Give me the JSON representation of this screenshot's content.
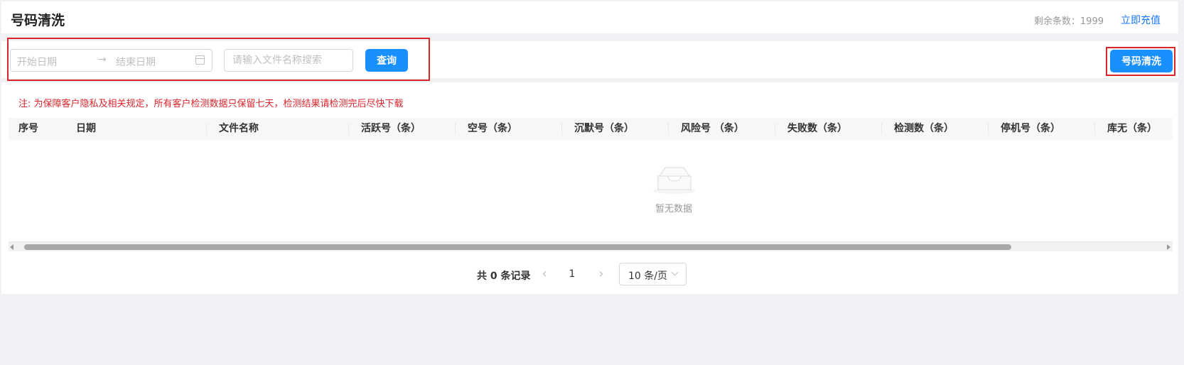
{
  "header": {
    "title": "号码清洗",
    "remaining": "剩余条数：1999",
    "recharge": "立即充值"
  },
  "filters": {
    "start_placeholder": "开始日期",
    "end_placeholder": "结束日期",
    "range_arrow": "→",
    "search_placeholder": "请输入文件名称搜索",
    "query_label": "查询"
  },
  "actions": {
    "clean_label": "号码清洗"
  },
  "notice": "注: 为保障客户隐私及相关规定，所有客户检测数据只保留七天，检测结果请检测完后尽快下载",
  "table": {
    "columns": [
      "序号",
      "日期",
      "文件名称",
      "活跃号（条）",
      "空号（条）",
      "沉默号（条）",
      "风险号 （条）",
      "失败数（条）",
      "检测数（条）",
      "停机号（条）",
      "库无（条）"
    ],
    "empty_text": "暂无数据"
  },
  "pagination": {
    "total": "共 0 条记录",
    "prev": "‹",
    "current_page": "1",
    "next": "›",
    "page_size": "10 条/页"
  },
  "colors": {
    "primary": "#1890ff",
    "warning": "#d9262c"
  }
}
